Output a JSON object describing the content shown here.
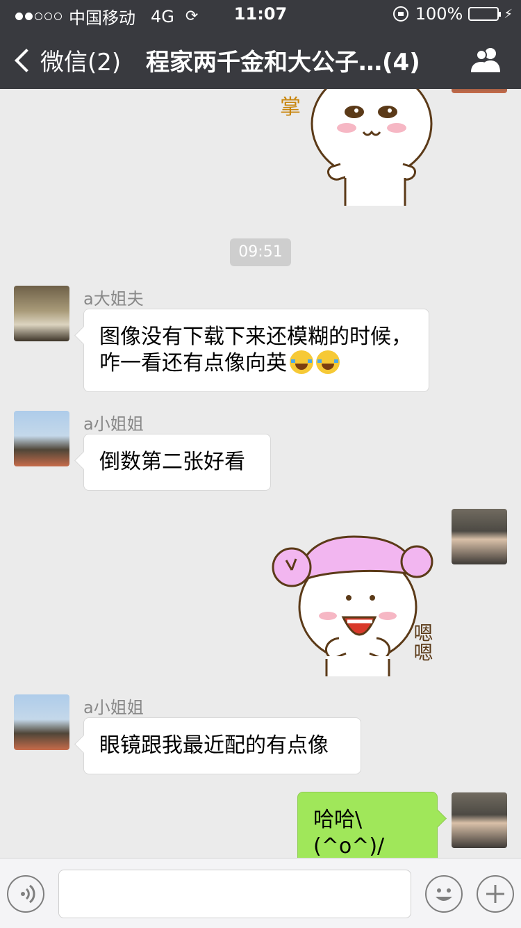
{
  "status_bar": {
    "carrier": "中国移动",
    "network": "4G",
    "time": "11:07",
    "battery": "100%"
  },
  "nav": {
    "back_label": "微信(2)",
    "title": "程家两千金和大公子…(4)"
  },
  "chat": {
    "timestamp": "09:51",
    "messages": [
      {
        "sender": "a大姐夫",
        "text": "图像没有下载下来还模糊的时候，咋一看还有点像向英"
      },
      {
        "sender": "a小姐姐",
        "text": "倒数第二张好看"
      },
      {
        "sender": "a小姐姐",
        "text": "眼镜跟我最近配的有点像"
      },
      {
        "sender": "me",
        "text": "哈哈\\(^o^)/"
      }
    ],
    "stickers": [
      {
        "from": "others",
        "caption": "掌"
      },
      {
        "from": "me",
        "caption": "嗯嗯"
      }
    ]
  },
  "colors": {
    "nav_bg": "#393a3f",
    "chat_bg": "#ebebeb",
    "out_bubble": "#a0e75a",
    "in_bubble": "#ffffff",
    "battery_fill": "#4cd964"
  }
}
